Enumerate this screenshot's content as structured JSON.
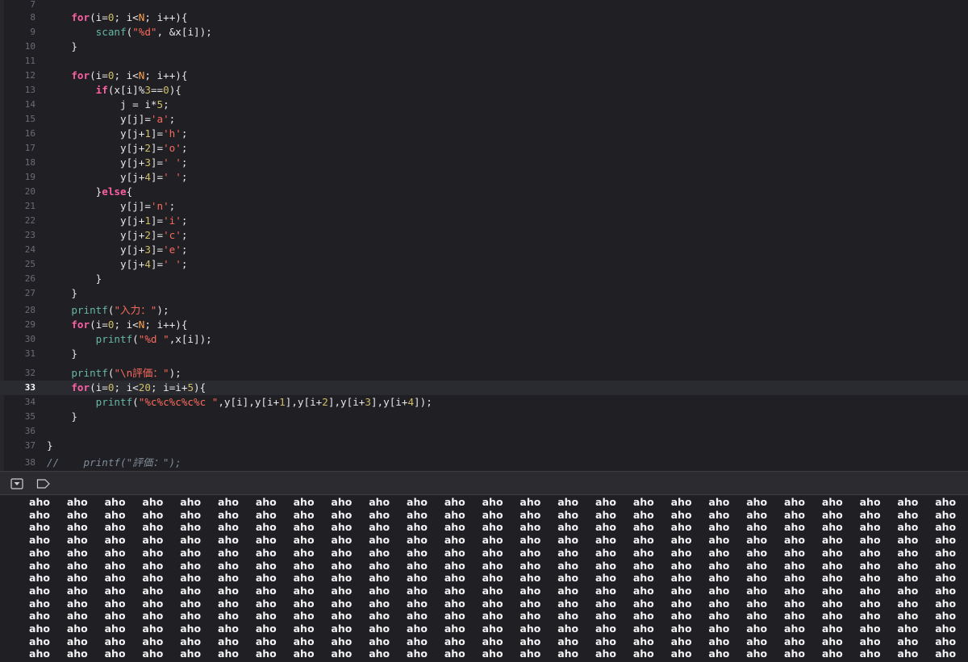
{
  "editor": {
    "current_line": 33,
    "lines": [
      {
        "n": "7",
        "html": ""
      },
      {
        "n": "8",
        "html": "    <span class=\"kw\">for</span>(i=<span class=\"num\">0</span>; i&lt;<span class=\"hl\">N</span>; i++){"
      },
      {
        "n": "9",
        "html": "        <span class=\"fn\">scanf</span>(<span class=\"str\">\"%d\"</span>, &amp;x[i]);"
      },
      {
        "n": "10",
        "html": "    }"
      },
      {
        "n": "11",
        "html": ""
      },
      {
        "n": "12",
        "html": "    <span class=\"kw\">for</span>(i=<span class=\"num\">0</span>; i&lt;<span class=\"hl\">N</span>; i++){"
      },
      {
        "n": "13",
        "html": "        <span class=\"kw\">if</span>(x[i]%<span class=\"num\">3</span>==<span class=\"num\">0</span>){"
      },
      {
        "n": "14",
        "html": "            j = i*<span class=\"num\">5</span>;"
      },
      {
        "n": "15",
        "html": "            y[j]=<span class=\"str\">'a'</span>;"
      },
      {
        "n": "16",
        "html": "            y[j+<span class=\"num\">1</span>]=<span class=\"str\">'h'</span>;"
      },
      {
        "n": "17",
        "html": "            y[j+<span class=\"num\">2</span>]=<span class=\"str\">'o'</span>;"
      },
      {
        "n": "18",
        "html": "            y[j+<span class=\"num\">3</span>]=<span class=\"str\">' '</span>;"
      },
      {
        "n": "19",
        "html": "            y[j+<span class=\"num\">4</span>]=<span class=\"str\">' '</span>;"
      },
      {
        "n": "20",
        "html": "        }<span class=\"kw\">else</span>{"
      },
      {
        "n": "21",
        "html": "            y[j]=<span class=\"str\">'n'</span>;"
      },
      {
        "n": "22",
        "html": "            y[j+<span class=\"num\">1</span>]=<span class=\"str\">'i'</span>;"
      },
      {
        "n": "23",
        "html": "            y[j+<span class=\"num\">2</span>]=<span class=\"str\">'c'</span>;"
      },
      {
        "n": "24",
        "html": "            y[j+<span class=\"num\">3</span>]=<span class=\"str\">'e'</span>;"
      },
      {
        "n": "25",
        "html": "            y[j+<span class=\"num\">4</span>]=<span class=\"str\">' '</span>;"
      },
      {
        "n": "26",
        "html": "        }"
      },
      {
        "n": "27",
        "html": "    }"
      },
      {
        "n": "28",
        "html": "    <span class=\"fn\">printf</span>(<span class=\"str\">\"入力：\"</span>);"
      },
      {
        "n": "29",
        "html": "    <span class=\"kw\">for</span>(i=<span class=\"num\">0</span>; i&lt;<span class=\"hl\">N</span>; i++){"
      },
      {
        "n": "30",
        "html": "        <span class=\"fn\">printf</span>(<span class=\"str\">\"%d \"</span>,x[i]);"
      },
      {
        "n": "31",
        "html": "    }"
      },
      {
        "n": "32",
        "html": "    <span class=\"fn\">printf</span>(<span class=\"str\">\"\\n評価：\"</span>);"
      },
      {
        "n": "33",
        "html": "    <span class=\"kw\">for</span>(i=<span class=\"num\">0</span>; i&lt;<span class=\"num\">20</span>; i=i+<span class=\"num\">5</span>){"
      },
      {
        "n": "34",
        "html": "        <span class=\"fn\">printf</span>(<span class=\"str\">\"%c%c%c%c%c \"</span>,y[i],y[i+<span class=\"num\">1</span>],y[i+<span class=\"num\">2</span>],y[i+<span class=\"num\">3</span>],y[i+<span class=\"num\">4</span>]);"
      },
      {
        "n": "35",
        "html": "    }"
      },
      {
        "n": "36",
        "html": ""
      },
      {
        "n": "37",
        "html": "}"
      },
      {
        "n": "38",
        "html": "<span class=\"cmt\">//    printf(\"評価：\");</span>"
      }
    ]
  },
  "debug_bar": {
    "icons": [
      "hide-debug-area-icon",
      "breakpoint-icon"
    ]
  },
  "console": {
    "output_word": "aho",
    "rows": 13,
    "columns": 25
  }
}
